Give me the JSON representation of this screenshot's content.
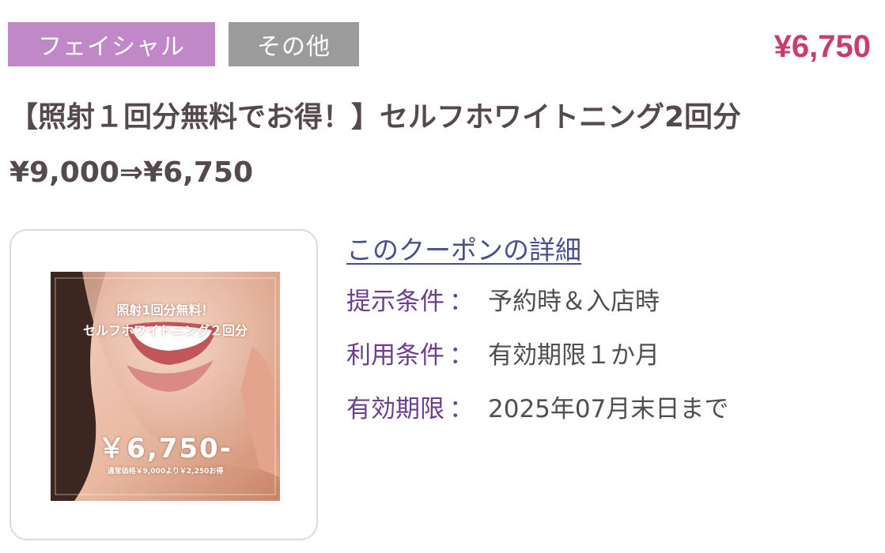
{
  "tags": {
    "category": "フェイシャル",
    "sub_category": "その他"
  },
  "price": "¥6,750",
  "title": "【照射１回分無料でお得！】セルフホワイトニング2回分 ¥9,000⇒¥6,750",
  "coupon_image": {
    "headline_line1": "照射1回分無料！",
    "headline_line2": "セルフホワイトニング２回分",
    "price": "￥6,750-",
    "note": "通常価格￥9,000より￥2,250お得"
  },
  "details": {
    "link_label": "このクーポンの詳細",
    "separator": "：",
    "rows": [
      {
        "label": "提示条件",
        "value": "予約時＆入店時"
      },
      {
        "label": "利用条件",
        "value": "有効期限１か月"
      },
      {
        "label": "有効期限",
        "value": "2025年07月末日まで"
      }
    ]
  },
  "colors": {
    "tag_facial": "#c188c7",
    "tag_other": "#9b9b9b",
    "price": "#c83d6b",
    "title": "#54494b",
    "link": "#4a4f8c",
    "label": "#6b3f8e"
  }
}
